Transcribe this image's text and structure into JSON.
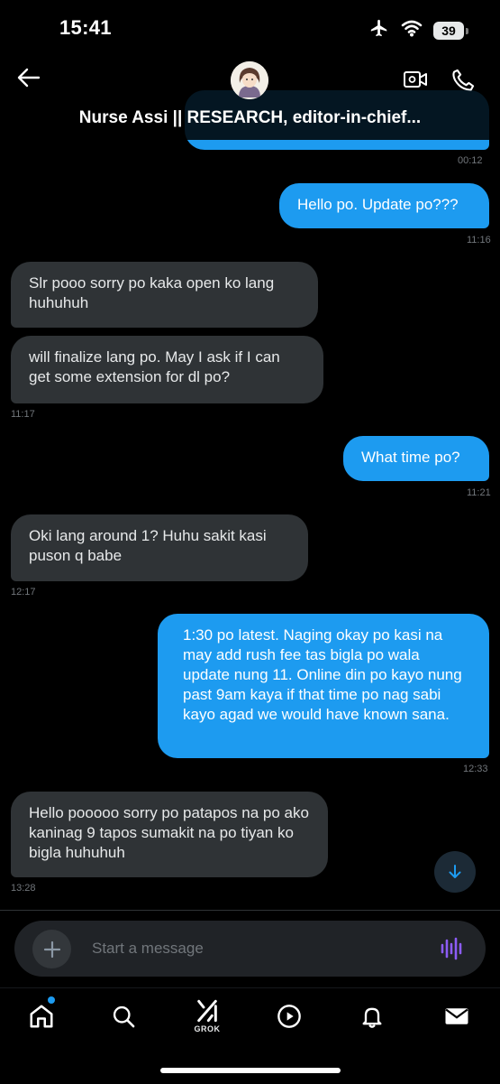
{
  "status_bar": {
    "time": "15:41",
    "battery": "39"
  },
  "header": {
    "title": "Nurse Assi || RESEARCH, editor-in-chief..."
  },
  "messages": [
    {
      "text": "Hello po. Update po???",
      "time": "11:16"
    },
    {
      "text": "Slr pooo sorry po kaka open ko lang huhuhuh"
    },
    {
      "text": "will finalize lang po. May I ask if I can get some extension for dl po?",
      "time": "11:17"
    },
    {
      "text": "What time po?",
      "time": "11:21"
    },
    {
      "text": "Oki lang around 1? Huhu sakit kasi puson q babe",
      "time": "12:17"
    },
    {
      "text": "1:30 po latest. Naging okay po kasi na may add rush fee tas bigla po wala update nung 11. Online din po kayo nung past 9am kaya if that time po nag sabi kayo agad we would have known sana.",
      "time": "12:33"
    },
    {
      "text": "Hello pooooo sorry po patapos na po ako kaninag 9 tapos sumakit na po tiyan ko bigla huhuhuh",
      "time": "13:28"
    }
  ],
  "top_partial_time": "00:12",
  "compose": {
    "placeholder": "Start a message"
  },
  "tabbar": {
    "grok_label": "GROK"
  },
  "colors": {
    "accent": "#1d9bf0",
    "incoming_bubble": "#2f3336",
    "background": "#000000"
  }
}
